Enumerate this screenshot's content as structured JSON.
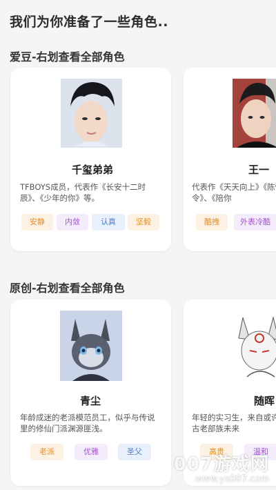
{
  "page_title": "我们为你准备了一些角色..",
  "sections": [
    {
      "title": "爱豆-右划查看全部角色",
      "cards": [
        {
          "name": "千玺弟弟",
          "desc": "TFBOYS成员，代表作《长安十二时辰》、《少年的你》等。",
          "tags": [
            "安静",
            "内敛",
            "认真",
            "坚毅"
          ]
        },
        {
          "name": "王一",
          "desc": "代表作《天天向上》《陈情令》、《陪你",
          "tags": [
            "酷拽",
            "外表冷酷"
          ]
        }
      ]
    },
    {
      "title": "原创-右划查看全部角色",
      "cards": [
        {
          "name": "青尘",
          "desc": "年龄成迷的老派模范员工，似乎与传说里的修仙门派渊源匪浅。",
          "tags": [
            "老派",
            "优雅",
            "圣父"
          ]
        },
        {
          "name": "随晖",
          "desc": "年轻的实习生，来自或许是古老部族未来",
          "tags": [
            "高贵",
            "温和"
          ]
        }
      ]
    }
  ],
  "watermark": {
    "main": "007游戏网",
    "url": "www.yx007.com"
  }
}
